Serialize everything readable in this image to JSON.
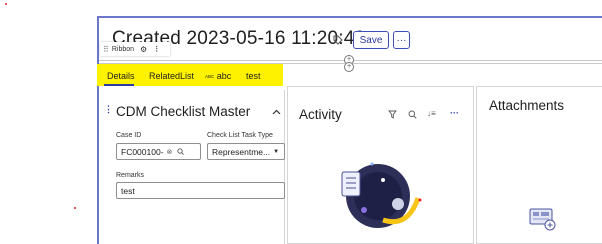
{
  "record": {
    "title": "Created 2023-05-16 11:20:40"
  },
  "header": {
    "save_label": "Save",
    "more_label": "···",
    "tag_icon": "tag-icon"
  },
  "ribbon": {
    "label": "Ribbon"
  },
  "tabs": [
    {
      "label": "Details",
      "active": true
    },
    {
      "label": "RelatedList",
      "active": false
    },
    {
      "label": "abc",
      "prefix": "ABC",
      "active": false
    },
    {
      "label": "test",
      "active": false
    }
  ],
  "form": {
    "title": "CDM Checklist Master",
    "case_id": {
      "label": "Case ID",
      "value": "FC000100-"
    },
    "checklist_type": {
      "label": "Check List Task Type",
      "value": "Representme..."
    },
    "remarks": {
      "label": "Remarks",
      "value": "test"
    }
  },
  "activity": {
    "title": "Activity"
  },
  "attachments": {
    "title": "Attachments"
  },
  "colors": {
    "accent": "#2a3a9e",
    "highlight": "#fff200",
    "frame": "#6b78c9"
  }
}
